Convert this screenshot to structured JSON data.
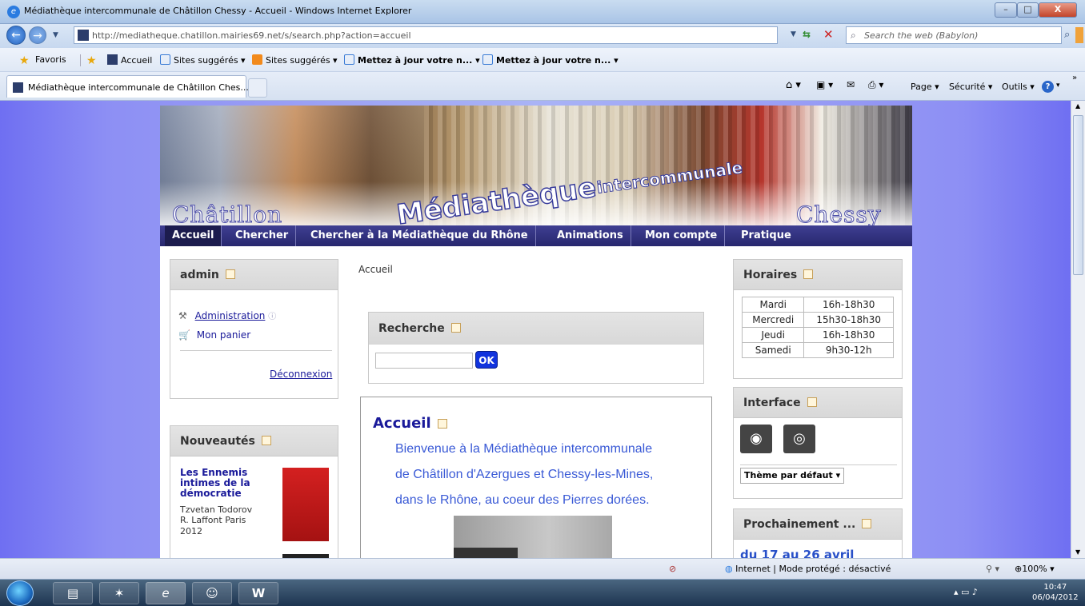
{
  "window": {
    "title": "Médiathèque intercommunale de Châtillon Chessy - Accueil - Windows Internet Explorer",
    "buttons": {
      "minimize": "–",
      "maximize": "□",
      "close": "X"
    }
  },
  "addressbar": {
    "url": "http://mediatheque.chatillon.mairies69.net/s/search.php?action=accueil",
    "search_placeholder": "Search the web (Babylon)"
  },
  "favorites": {
    "label": "Favoris",
    "items": [
      {
        "label": "Accueil",
        "bold": false
      },
      {
        "label": "Sites suggérés ▾",
        "bold": false
      },
      {
        "label": "Sites suggérés ▾",
        "bold": false
      },
      {
        "label": "Mettez à jour votre n... ▾",
        "bold": true
      },
      {
        "label": "Mettez à jour votre n... ▾",
        "bold": true
      }
    ]
  },
  "tab": {
    "label": "Médiathèque intercommunale de Châtillon Ches..."
  },
  "commandbar": {
    "page": "Page ▾",
    "security": "Sécurité ▾",
    "tools": "Outils ▾"
  },
  "banner": {
    "left_city": "Châtillon",
    "right_city": "Chessy",
    "title": "Médiathèque",
    "subtitle": "intercommunale"
  },
  "nav": [
    "Accueil",
    "Chercher",
    "Chercher à la Médiathèque du Rhône",
    "Animations",
    "Mon compte",
    "Pratique"
  ],
  "breadcrumb": "Accueil",
  "admin_box": {
    "title": "admin",
    "administration": "Administration",
    "cart": "Mon panier",
    "logout": "Déconnexion"
  },
  "news_box": {
    "title": "Nouveautés",
    "book_title": "Les Ennemis intimes de la démocratie",
    "author": "Tzvetan Todorov",
    "publisher": "R. Laffont Paris",
    "year": "2012"
  },
  "search_box": {
    "title": "Recherche",
    "button": "OK"
  },
  "welcome": {
    "title": "Accueil",
    "lines": [
      "Bienvenue à la Médiathèque intercommunale",
      "de Châtillon d'Azergues et Chessy-les-Mines,",
      "dans le Rhône, au coeur des Pierres dorées."
    ]
  },
  "hours_box": {
    "title": "Horaires",
    "rows": [
      [
        "Mardi",
        "16h-18h30"
      ],
      [
        "Mercredi",
        "15h30-18h30"
      ],
      [
        "Jeudi",
        "16h-18h30"
      ],
      [
        "Samedi",
        "9h30-12h"
      ]
    ]
  },
  "interface_box": {
    "title": "Interface",
    "theme": "Thème par défaut"
  },
  "upcoming_box": {
    "title": "Prochainement ...",
    "date": "du 17 au 26 avril"
  },
  "statusbar": {
    "zone": "Internet | Mode protégé : désactivé",
    "zoom": "100%"
  },
  "clock": {
    "time": "10:47",
    "date": "06/04/2012"
  }
}
